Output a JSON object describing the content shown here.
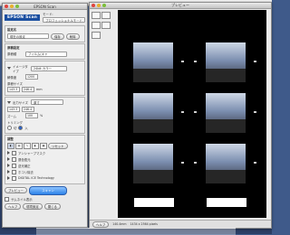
{
  "left_window": {
    "title": "EPSON Scan",
    "logo": "EPSON Scan",
    "mode_label": "モード:",
    "mode_value": "プロフェッショナルモード",
    "setting_label": "設定名",
    "setting_value": "現在の設定",
    "save_label": "保存",
    "delete_label": "削除",
    "original_header": "原稿設定",
    "document_type_label": "原稿種",
    "document_type_value": "フィルム(キャ",
    "image_type_label": "イメージタイプ",
    "image_type_value": "24bit カラー",
    "resolution_label": "解像度",
    "resolution_value": "1200",
    "size_label": "原稿サイズ",
    "size_w": "143.3",
    "size_h": "246.4",
    "size_unit": "mm",
    "output_header": "出力サイズ",
    "output_value": "原寸",
    "out_w": "143.3",
    "out_h": "246.4",
    "zoom_label": "ズーム",
    "zoom_value": "100",
    "zoom_unit": "%",
    "trim_label": "トリミング",
    "trim_off": "切",
    "trim_on": "入",
    "adjust_header": "調整",
    "auto_label": "リセット",
    "adj_items": [
      "アンシャープマスク",
      "退色復元",
      "逆光補正",
      "ホコリ除去",
      "DIGITAL ICE Technology"
    ],
    "preview_button": "プレビュー",
    "scan_button": "スキャン",
    "thumb_label": "サムネイル表示",
    "help_button": "ヘルプ",
    "config_button": "環境設定",
    "close_button": "閉じる"
  },
  "right_window": {
    "title": "プレビュー",
    "help_button": "ヘルプ",
    "status_size": "140.4mm",
    "status_coords": "1434 x 2564 pixels"
  },
  "colors": {
    "accent": "#2b82e8",
    "logo": "#1b4fa0",
    "desktop": "#3f5a8a"
  }
}
